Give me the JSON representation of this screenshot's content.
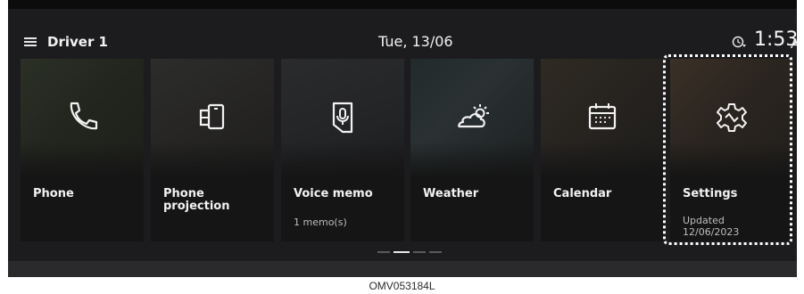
{
  "status_bar": {
    "driver": "Driver 1",
    "date": "Tue, 13/06",
    "time": "1:53",
    "ampm": "AM",
    "menu_icon": "hamburger-menu-icon",
    "timer_icon": "timer-icon"
  },
  "tiles": [
    {
      "label": "Phone",
      "sub": "",
      "icon": "phone-icon"
    },
    {
      "label": "Phone\nprojection",
      "sub": "",
      "icon": "phone-projection-icon"
    },
    {
      "label": "Voice memo",
      "sub": "1 memo(s)",
      "icon": "voice-memo-icon"
    },
    {
      "label": "Weather",
      "sub": "",
      "icon": "weather-icon"
    },
    {
      "label": "Calendar",
      "sub": "",
      "icon": "calendar-icon"
    },
    {
      "label": "Settings",
      "sub": "Updated\n12/06/2023",
      "icon": "gear-icon"
    }
  ],
  "pager": {
    "pages": 4,
    "current_page": 2
  },
  "caption": "OMV053184L"
}
